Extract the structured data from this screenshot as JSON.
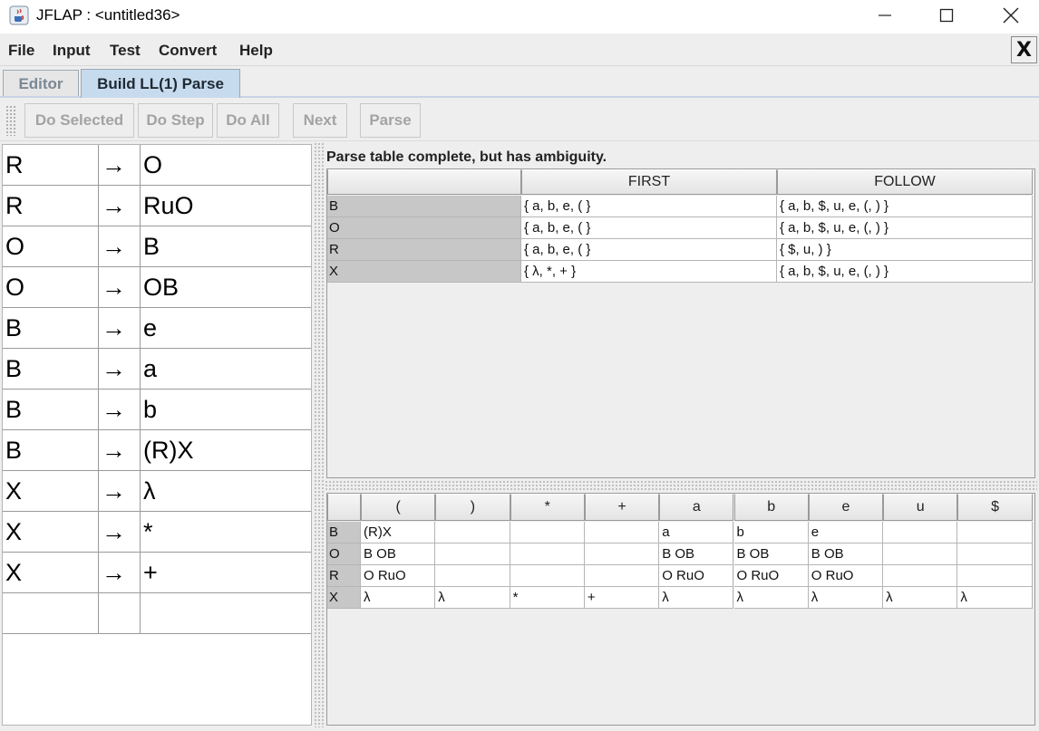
{
  "window": {
    "title": "JFLAP : <untitled36>"
  },
  "menu": [
    "File",
    "Input",
    "Test",
    "Convert",
    "Help"
  ],
  "close_tab_label": "X",
  "tabs": [
    "Editor",
    "Build LL(1) Parse"
  ],
  "toolbar": {
    "do_selected": "Do Selected",
    "do_step": "Do Step",
    "do_all": "Do All",
    "next": "Next",
    "parse": "Parse"
  },
  "grammar": {
    "arrow": "→",
    "rows": [
      {
        "lhs": "R",
        "rhs": "O"
      },
      {
        "lhs": "R",
        "rhs": "RuO"
      },
      {
        "lhs": "O",
        "rhs": "B"
      },
      {
        "lhs": "O",
        "rhs": "OB"
      },
      {
        "lhs": "B",
        "rhs": "e"
      },
      {
        "lhs": "B",
        "rhs": "a"
      },
      {
        "lhs": "B",
        "rhs": "b"
      },
      {
        "lhs": "B",
        "rhs": "(R)X"
      },
      {
        "lhs": "X",
        "rhs": "λ"
      },
      {
        "lhs": "X",
        "rhs": "*"
      },
      {
        "lhs": "X",
        "rhs": "+"
      }
    ]
  },
  "status": "Parse table complete, but has ambiguity.",
  "first_follow": {
    "headers": [
      "",
      "FIRST",
      "FOLLOW"
    ],
    "rows": [
      {
        "symbol": "B",
        "first": "{ a, b, e, ( }",
        "follow": "{ a, b, $, u, e, (, ) }"
      },
      {
        "symbol": "O",
        "first": "{ a, b, e, ( }",
        "follow": "{ a, b, $, u, e, (, ) }"
      },
      {
        "symbol": "R",
        "first": "{ a, b, e, ( }",
        "follow": "{ $, u, ) }"
      },
      {
        "symbol": "X",
        "first": "{ λ, *, + }",
        "follow": "{ a, b, $, u, e, (, ) }"
      }
    ]
  },
  "parse_table": {
    "headers": [
      "",
      "(",
      ")",
      "*",
      "+",
      "a",
      "b",
      "e",
      "u",
      "$"
    ],
    "rows": [
      {
        "symbol": "B",
        "cells": [
          "(R)X",
          "",
          "",
          "",
          "a",
          "b",
          "e",
          "",
          ""
        ]
      },
      {
        "symbol": "O",
        "cells": [
          "B OB",
          "",
          "",
          "",
          "B OB",
          "B OB",
          "B OB",
          "",
          ""
        ]
      },
      {
        "symbol": "R",
        "cells": [
          "O RuO",
          "",
          "",
          "",
          "O RuO",
          "O RuO",
          "O RuO",
          "",
          ""
        ]
      },
      {
        "symbol": "X",
        "cells": [
          "λ",
          "λ",
          "*",
          "+",
          "λ",
          "λ",
          "λ",
          "λ",
          "λ"
        ]
      }
    ]
  }
}
